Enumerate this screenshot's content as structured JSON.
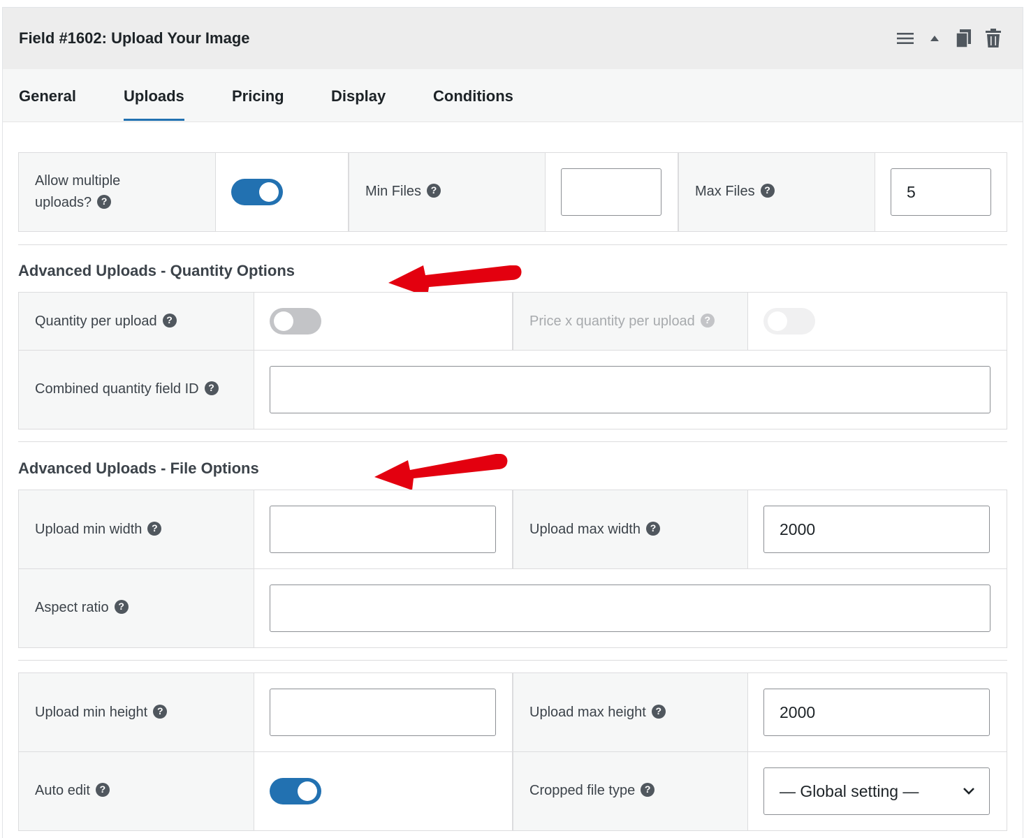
{
  "header": {
    "title": "Field #1602: Upload Your Image"
  },
  "tabs": [
    {
      "label": "General"
    },
    {
      "label": "Uploads"
    },
    {
      "label": "Pricing"
    },
    {
      "label": "Display"
    },
    {
      "label": "Conditions"
    }
  ],
  "active_tab": "Uploads",
  "uploads": {
    "allow_multiple_line1": "Allow multiple",
    "allow_multiple_line2": "uploads?",
    "allow_multiple_on": true,
    "min_files_label": "Min Files",
    "min_files_value": "",
    "max_files_label": "Max Files",
    "max_files_value": "5"
  },
  "quantity_section": {
    "title": "Advanced Uploads - Quantity Options",
    "qty_per_upload_label": "Quantity per upload",
    "qty_per_upload_on": false,
    "price_x_qty_label": "Price x quantity per upload",
    "price_x_qty_on": false,
    "combined_qty_label": "Combined quantity field ID",
    "combined_qty_value": ""
  },
  "file_section": {
    "title": "Advanced Uploads - File Options",
    "min_width_label": "Upload min width",
    "min_width_value": "",
    "max_width_label": "Upload max width",
    "max_width_value": "2000",
    "aspect_ratio_label": "Aspect ratio",
    "aspect_ratio_value": ""
  },
  "dimension_section": {
    "min_height_label": "Upload min height",
    "min_height_value": "",
    "max_height_label": "Upload max height",
    "max_height_value": "2000",
    "auto_edit_label": "Auto edit",
    "auto_edit_on": true,
    "cropped_type_label": "Cropped file type",
    "cropped_type_value": "— Global setting —"
  },
  "help_glyph": "?",
  "icons": [
    "menu-icon",
    "collapse-arrow-icon",
    "duplicate-icon",
    "trash-icon",
    "help-icon",
    "chevron-down-icon"
  ],
  "colors": {
    "accent": "#2271b1",
    "annotation_arrow": "#e3000f",
    "header_bg": "#ededed",
    "label_bg": "#f6f7f7"
  }
}
